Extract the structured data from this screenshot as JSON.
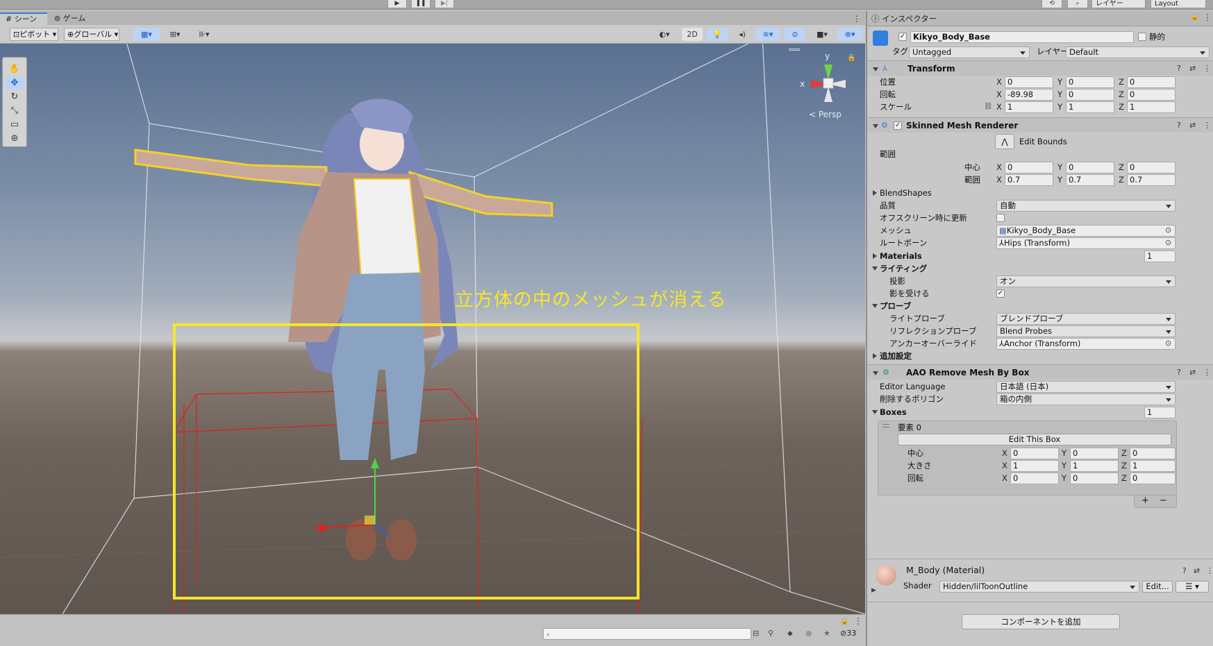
{
  "topbar": {
    "play_icon": "play-icon",
    "pause_icon": "pause-icon",
    "step_icon": "step-icon",
    "history_icon": "history-icon",
    "search_icon": "search-icon",
    "layers_label": "レイヤー",
    "layout_label": "Layout"
  },
  "scene": {
    "tabs": [
      {
        "label": "シーン",
        "icon": "hash-icon"
      },
      {
        "label": "ゲーム",
        "icon": "gamepad-icon"
      }
    ],
    "toolbar": {
      "pivot_label": "ピボット",
      "global_label": "グローバル",
      "mode_2d": "2D"
    },
    "gizmo": {
      "x_label": "x",
      "y_label": "y",
      "persp_label": "< Persp"
    },
    "annotation": "立方体の中のメッシュが消える",
    "status": {
      "visible_count": "33"
    },
    "colors": {
      "highlight": "#f5e62a",
      "box_gizmo": "#e02020"
    }
  },
  "inspector": {
    "tab_label": "インスペクター",
    "object": {
      "name": "Kikyo_Body_Base",
      "static_label": "静的",
      "tag_label": "タグ",
      "tag_value": "Untagged",
      "layer_label": "レイヤー",
      "layer_value": "Default"
    },
    "transform": {
      "title": "Transform",
      "position_label": "位置",
      "position": {
        "x": "0",
        "y": "0",
        "z": "0"
      },
      "rotation_label": "回転",
      "rotation": {
        "x": "-89.98",
        "y": "0",
        "z": "0"
      },
      "scale_label": "スケール",
      "scale": {
        "x": "1",
        "y": "1",
        "z": "1"
      }
    },
    "smr": {
      "title": "Skinned Mesh Renderer",
      "edit_bounds": "Edit Bounds",
      "bounds_label": "範囲",
      "center_label": "中心",
      "center": {
        "x": "0",
        "y": "0",
        "z": "0"
      },
      "extent_label": "範囲",
      "extent": {
        "x": "0.7",
        "y": "0.7",
        "z": "0.7"
      },
      "blendshapes_label": "BlendShapes",
      "quality_label": "品質",
      "quality_value": "自動",
      "offscreen_label": "オフスクリーン時に更新",
      "mesh_label": "メッシュ",
      "mesh_value": "Kikyo_Body_Base",
      "rootbone_label": "ルートボーン",
      "rootbone_value": "Hips (Transform)",
      "materials_label": "Materials",
      "materials_count": "1",
      "lighting_label": "ライティング",
      "cast_label": "投影",
      "cast_value": "オン",
      "receive_label": "影を受ける",
      "probes_label": "プローブ",
      "light_probe_label": "ライトプローブ",
      "light_probe_value": "ブレンドプローブ",
      "reflection_label": "リフレクションプローブ",
      "reflection_value": "Blend Probes",
      "anchor_label": "アンカーオーバーライド",
      "anchor_value": "Anchor (Transform)",
      "additional_label": "追加設定"
    },
    "aao": {
      "title": "AAO Remove Mesh By Box",
      "lang_label": "Editor Language",
      "lang_value": "日本語 (日本)",
      "poly_label": "削除するポリゴン",
      "poly_value": "箱の内側",
      "boxes_label": "Boxes",
      "boxes_count": "1",
      "element_label": "要素 0",
      "edit_box": "Edit This Box",
      "center_label": "中心",
      "center": {
        "x": "0",
        "y": "0",
        "z": "0"
      },
      "size_label": "大きさ",
      "size": {
        "x": "1",
        "y": "1",
        "z": "1"
      },
      "rotation_label": "回転",
      "rotation": {
        "x": "0",
        "y": "0",
        "z": "0"
      },
      "plus": "+",
      "minus": "−"
    },
    "material": {
      "name": "M_Body (Material)",
      "shader_label": "Shader",
      "shader_value": "Hidden/lilToonOutline",
      "edit_label": "Edit..."
    },
    "add_component": "コンポーネントを追加",
    "axes": {
      "x": "X",
      "y": "Y",
      "z": "Z"
    }
  }
}
